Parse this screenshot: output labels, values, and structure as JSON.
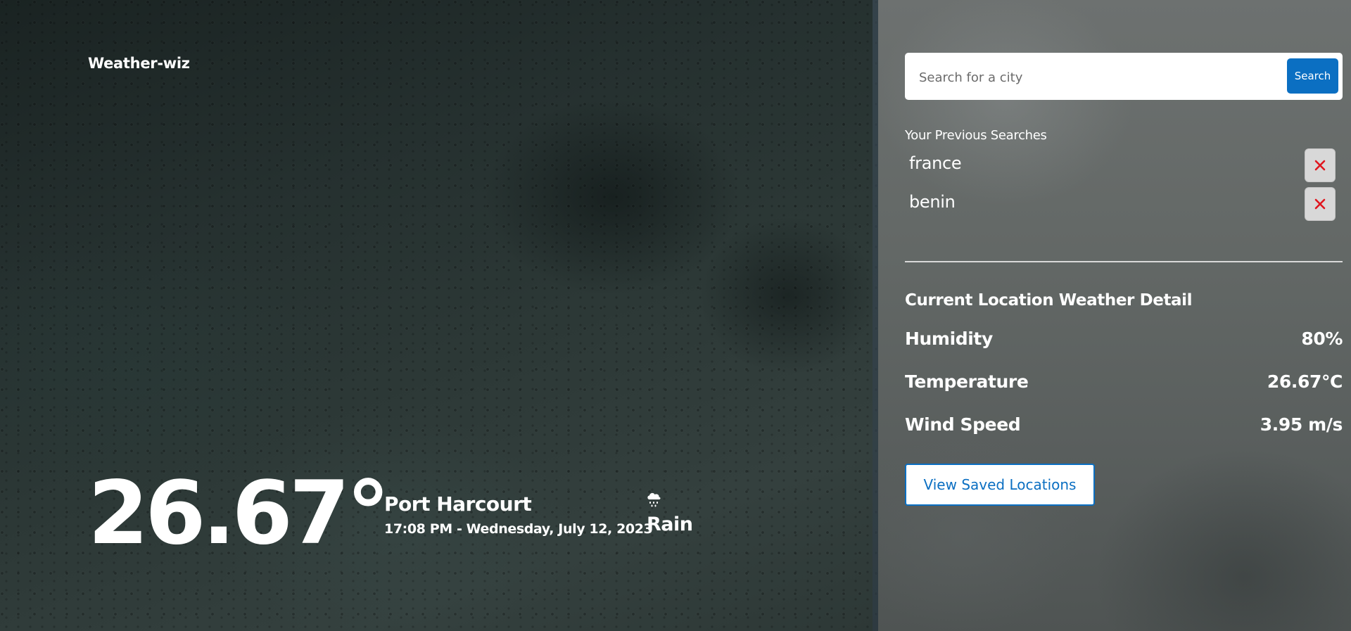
{
  "brand": {
    "name": "Weather-wiz"
  },
  "current": {
    "temperature": "26.67°",
    "city": "Port Harcourt",
    "datetime": "17:08 PM - Wednesday, July 12, 2023",
    "condition": "Rain",
    "condition_icon": "cloud-rain-icon"
  },
  "search": {
    "placeholder": "Search for a city",
    "value": "",
    "button_label": "Search"
  },
  "previous_searches": {
    "title": "Your Previous Searches",
    "items": [
      {
        "label": "france",
        "delete_icon": "close-icon"
      },
      {
        "label": "benin",
        "delete_icon": "close-icon"
      }
    ]
  },
  "details": {
    "title": "Current Location Weather Detail",
    "rows": [
      {
        "label": "Humidity",
        "value": "80%"
      },
      {
        "label": "Temperature",
        "value": "26.67°C"
      },
      {
        "label": "Wind Speed",
        "value": "3.95 m/s"
      }
    ]
  },
  "saved_locations": {
    "button_label": "View Saved Locations"
  },
  "colors": {
    "accent": "#0b6fc2",
    "delete": "#e0161e",
    "text": "#ffffff"
  }
}
